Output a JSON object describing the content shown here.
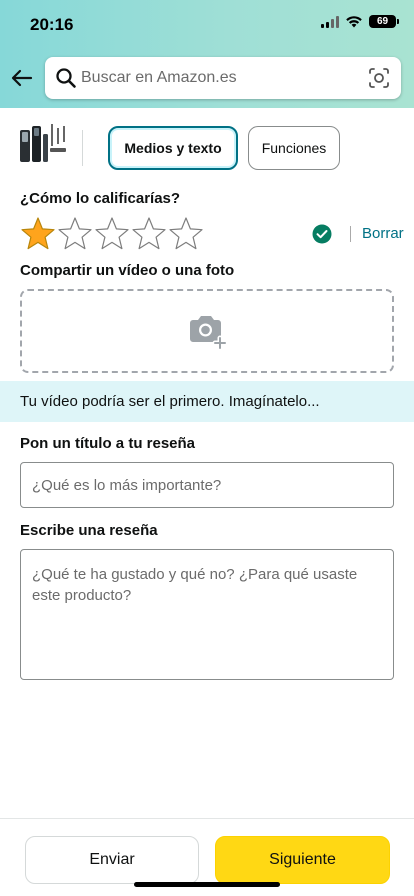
{
  "status_bar": {
    "time": "20:16",
    "battery": "69"
  },
  "search": {
    "placeholder": "Buscar en Amazon.es"
  },
  "tabs": [
    {
      "label": "Medios y texto",
      "selected": true
    },
    {
      "label": "Funciones",
      "selected": false
    }
  ],
  "rating": {
    "question": "¿Cómo lo calificarías?",
    "value": 1,
    "max": 5,
    "clear_label": "Borrar"
  },
  "media": {
    "label": "Compartir un vídeo o una foto",
    "banner": "Tu vídeo podría ser el primero. Imagínatelo..."
  },
  "review_title": {
    "label": "Pon un título a tu reseña",
    "placeholder": "¿Qué es lo más importante?"
  },
  "review_body": {
    "label": "Escribe una reseña",
    "placeholder": "¿Qué te ha gustado y qué no? ¿Para qué usaste este producto?"
  },
  "footer": {
    "send_label": "Enviar",
    "next_label": "Siguiente"
  },
  "colors": {
    "link": "#007185",
    "primary_button": "#ffd814",
    "star": "#ffa41c",
    "banner": "#def5f8"
  }
}
